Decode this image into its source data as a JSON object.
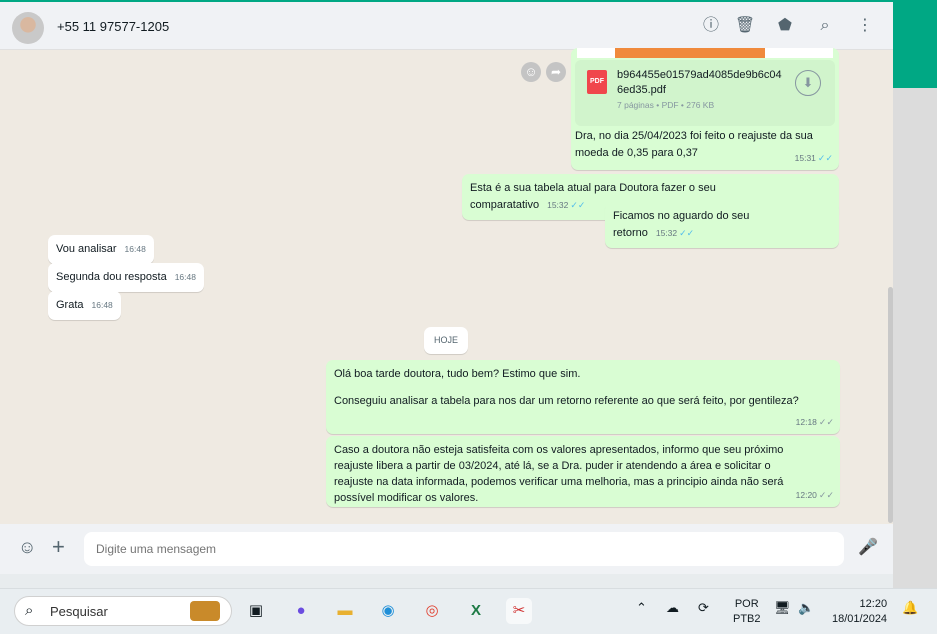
{
  "header": {
    "contact": "+55 11 97577-1205",
    "icons": [
      "info-icon",
      "trash-icon",
      "label-icon",
      "search-icon",
      "menu-icon"
    ]
  },
  "messages": {
    "pdf": {
      "filename_1": "b964455e01579ad4085de9b6c04",
      "filename_2": "6ed35.pdf",
      "meta": "7 páginas • PDF • 276 KB",
      "badge": "PDF"
    },
    "m1": {
      "line1": "Dra, no dia 25/04/2023 foi feito o reajuste da sua",
      "line2": "moeda de 0,35 para 0,37",
      "time": "15:31"
    },
    "m2": {
      "text": "Esta é a sua tabela atual para Doutora fazer o seu comparatativo",
      "time": "15:32"
    },
    "m3": {
      "text": "Ficamos no aguardo do seu retorno",
      "time": "15:32"
    },
    "in1": {
      "text": "Vou analisar",
      "time": "16:48"
    },
    "in2": {
      "text": "Segunda dou resposta",
      "time": "16:48"
    },
    "in3": {
      "text": "Grata",
      "time": "16:48"
    },
    "date": "HOJE",
    "m4": {
      "line1": "Olá boa tarde doutora, tudo bem? Estimo que sim.",
      "line2": "Conseguiu analisar a tabela para nos dar um retorno referente ao que será feito, por gentileza?",
      "time": "12:18"
    },
    "m5": {
      "text": "Caso a doutora não esteja satisfeita com os valores apresentados, informo que seu próximo reajuste libera a partir de 03/2024, até lá, se a Dra. puder ir atendendo a área e solicitar o reajuste na data informada, podemos verificar uma melhoria, mas a principio ainda não será possível modificar os valores.",
      "time": "12:20"
    }
  },
  "footer": {
    "placeholder": "Digite uma mensagem"
  },
  "taskbar": {
    "search": "Pesquisar",
    "lang1": "POR",
    "lang2": "PTB2",
    "time": "12:20",
    "date": "18/01/2024"
  },
  "colors": {
    "accent": "#00a884",
    "outgoing": "#d9fdd3",
    "tick": "#53bdeb"
  }
}
